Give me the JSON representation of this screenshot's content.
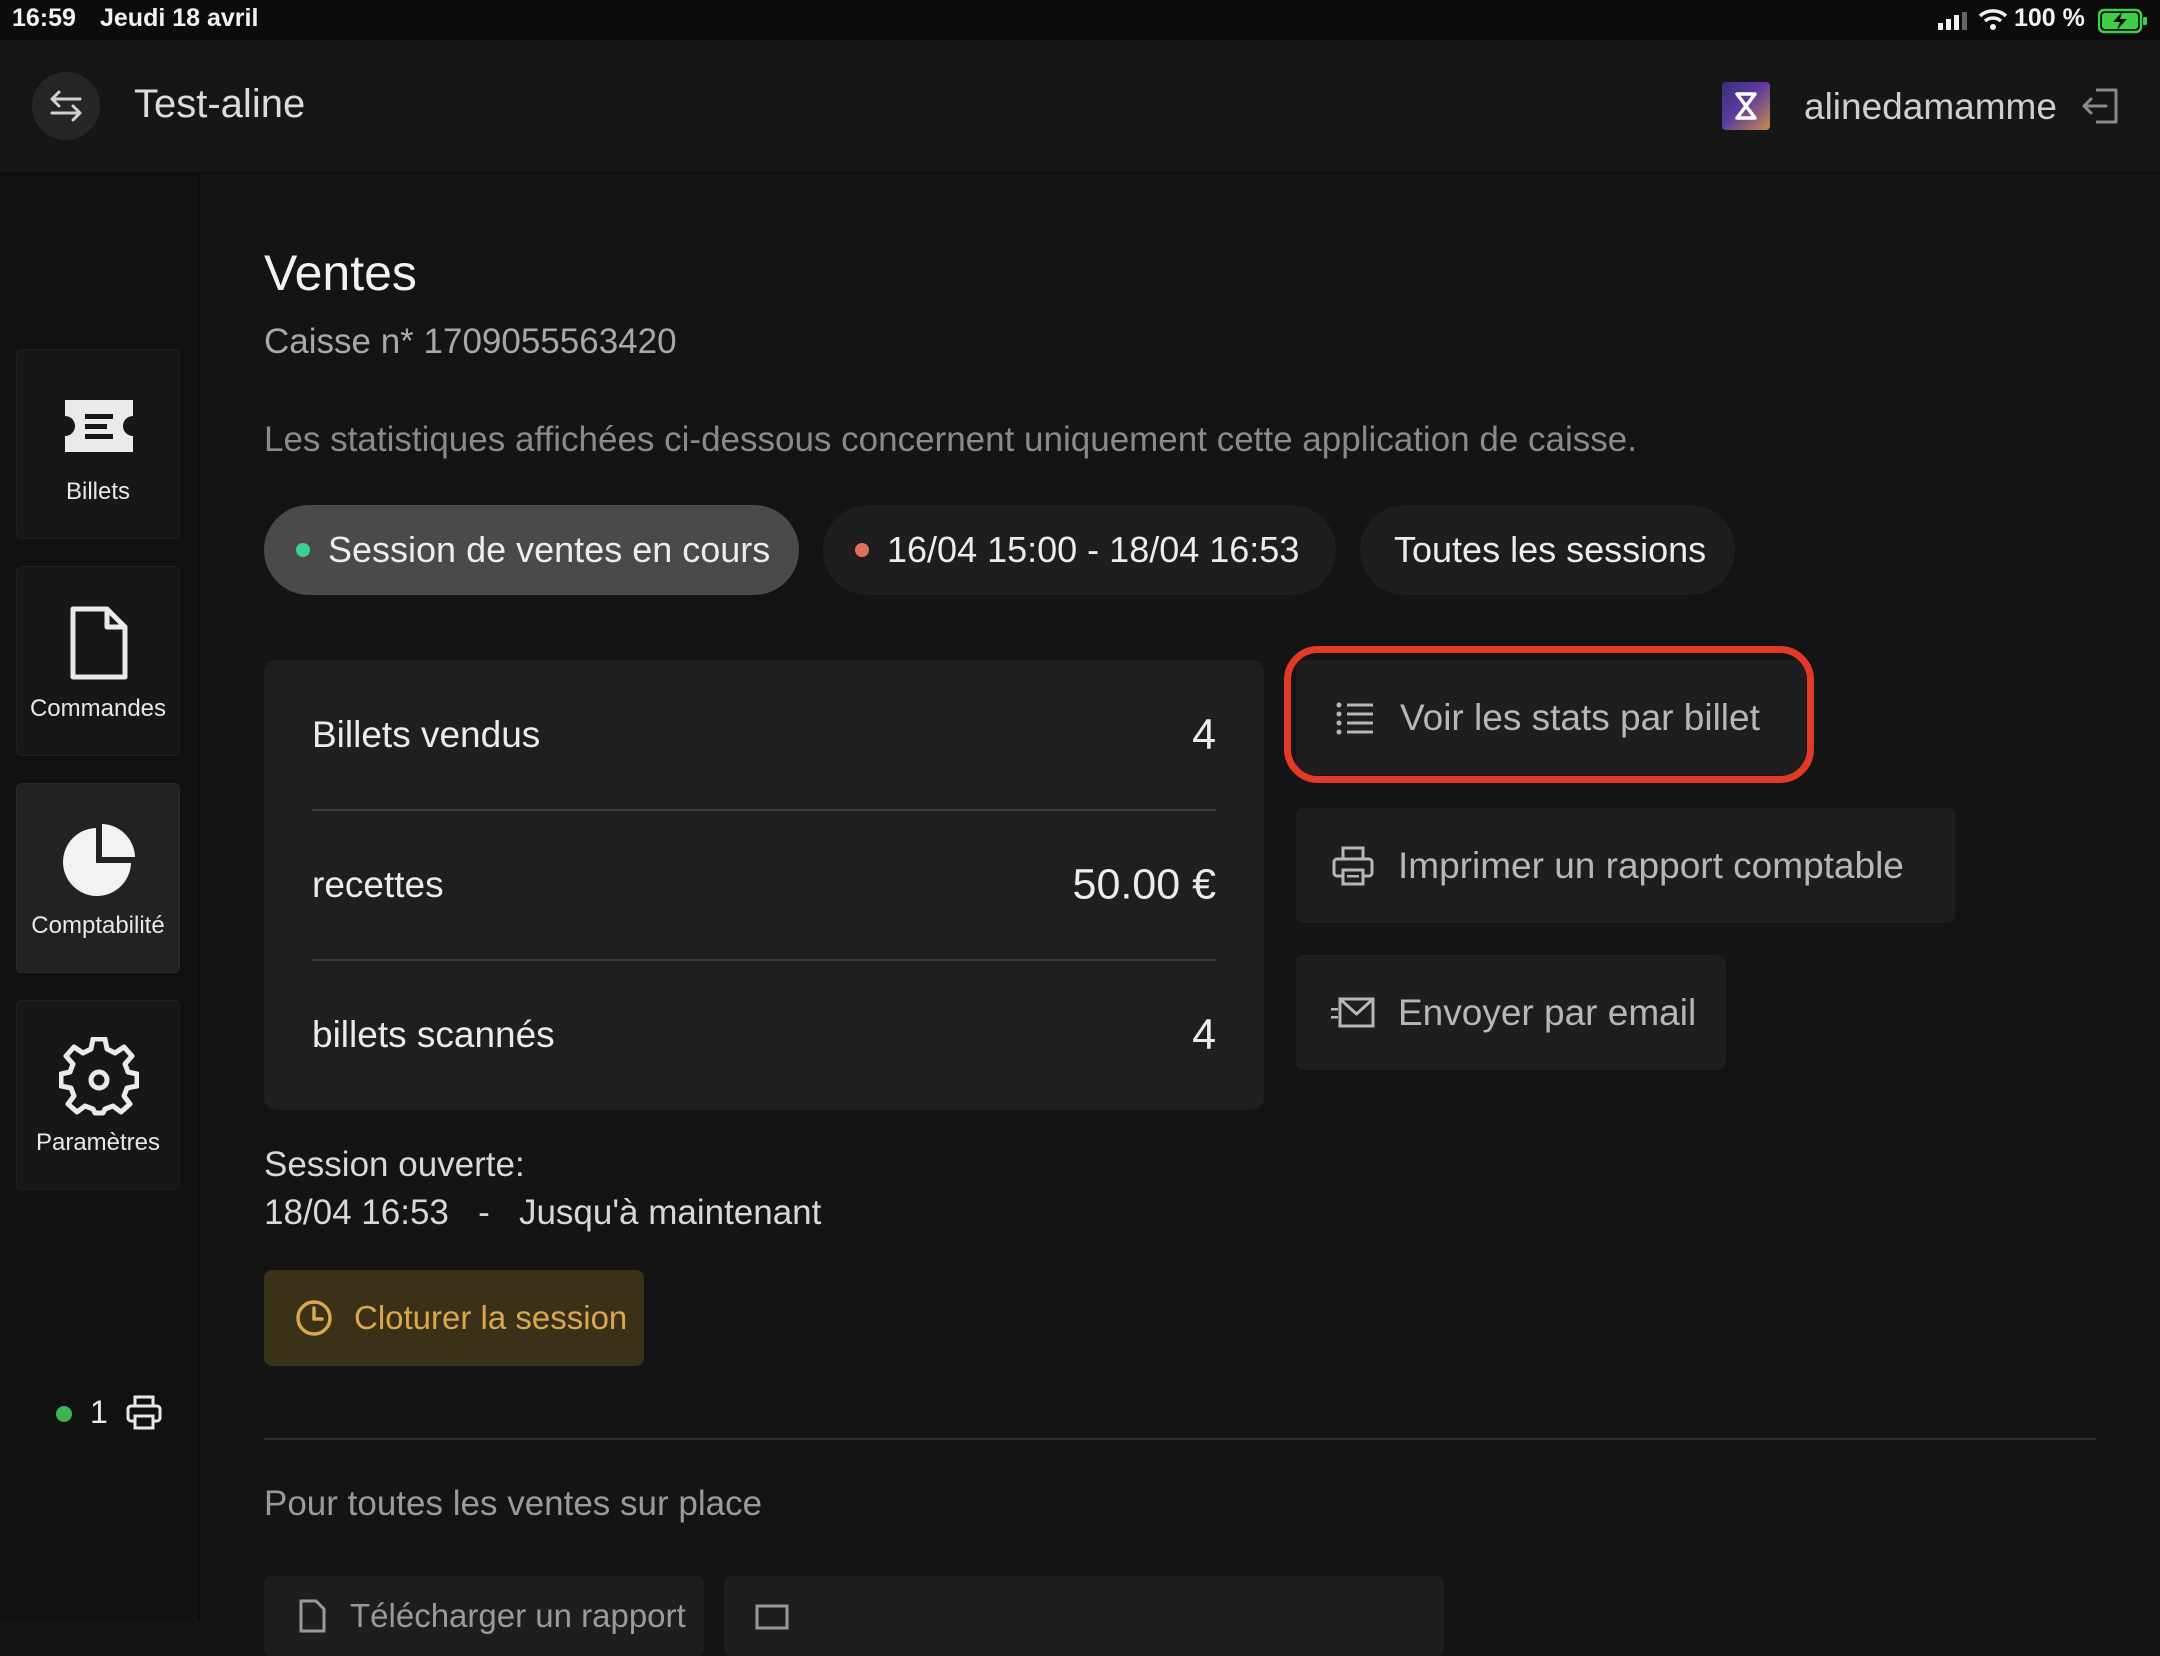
{
  "status_bar": {
    "time": "16:59",
    "date": "Jeudi 18 avril",
    "battery": "100 %"
  },
  "header": {
    "event_title": "Test-aline",
    "username": "alinedamamme"
  },
  "sidebar": {
    "items": [
      {
        "label": "Billets",
        "icon": "ticket-icon"
      },
      {
        "label": "Commandes",
        "icon": "document-icon"
      },
      {
        "label": "Comptabilité",
        "icon": "pie-chart-icon",
        "active": true
      },
      {
        "label": "Paramètres",
        "icon": "gear-icon"
      }
    ],
    "printer_count": "1"
  },
  "main": {
    "title": "Ventes",
    "register": "Caisse n* 1709055563420",
    "info": "Les statistiques affichées ci-dessous concernent uniquement cette application de caisse.",
    "session_filters": [
      {
        "label": "Session de ventes en cours",
        "dot_color": "#3ecf8e",
        "active": true
      },
      {
        "label": "16/04 15:00 - 18/04 16:53",
        "dot_color": "#e0705a",
        "active": false
      },
      {
        "label": "Toutes les sessions",
        "active": false
      }
    ],
    "stats": [
      {
        "label": "Billets vendus",
        "value": "4"
      },
      {
        "label": "recettes",
        "value": "50.00 €"
      },
      {
        "label": "billets scannés",
        "value": "4"
      }
    ],
    "actions": {
      "stats_per_ticket": "Voir les stats par billet",
      "print_report": "Imprimer un rapport comptable",
      "send_email": "Envoyer par email"
    },
    "session": {
      "open_label": "Session ouverte:",
      "start": "18/04 16:53",
      "separator": "-",
      "end": "Jusqu'à maintenant",
      "close_button": "Cloturer la session"
    },
    "onsite": {
      "title": "Pour toutes les ventes sur place",
      "download_report": "Télécharger un rapport"
    }
  },
  "colors": {
    "highlight": "#e13a26",
    "close_button_text": "#d9a84a",
    "online_dot": "#3fb34f"
  }
}
